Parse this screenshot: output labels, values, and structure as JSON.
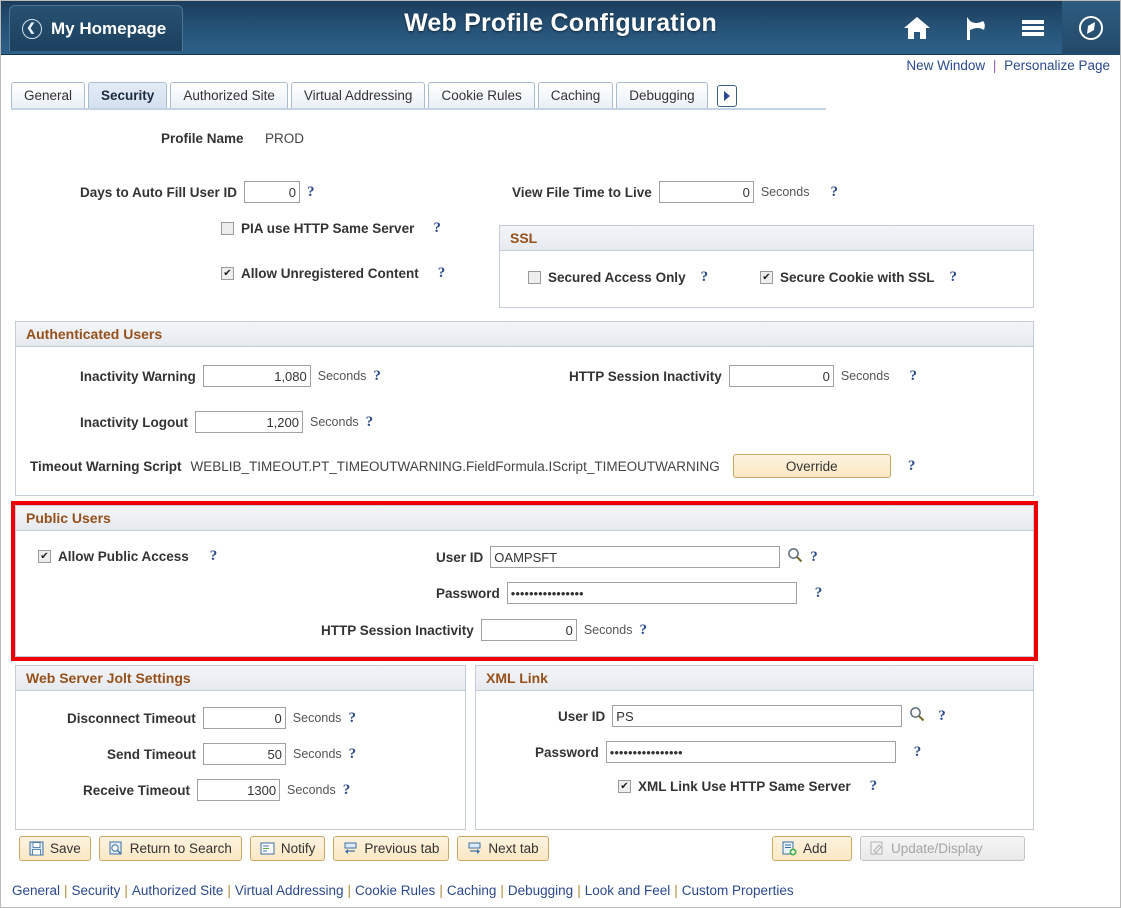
{
  "header": {
    "homepage_label": "My Homepage",
    "title": "Web Profile Configuration",
    "icons": [
      "home-icon",
      "flag-icon",
      "menu-icon",
      "navigator-icon"
    ]
  },
  "util": {
    "new_window": "New Window",
    "separator": "|",
    "personalize": "Personalize Page"
  },
  "tabs": [
    {
      "label": "General",
      "active": false
    },
    {
      "label": "Security",
      "active": true
    },
    {
      "label": "Authorized Site",
      "active": false
    },
    {
      "label": "Virtual Addressing",
      "active": false
    },
    {
      "label": "Cookie Rules",
      "active": false
    },
    {
      "label": "Caching",
      "active": false
    },
    {
      "label": "Debugging",
      "active": false
    }
  ],
  "profile": {
    "name_label": "Profile Name",
    "name_value": "PROD"
  },
  "top": {
    "days_autofill_label": "Days to Auto Fill User ID",
    "days_autofill_value": "0",
    "pia_same_server_label": "PIA use HTTP Same Server",
    "pia_same_server_checked": false,
    "allow_unregistered_label": "Allow Unregistered Content",
    "allow_unregistered_checked": true,
    "view_file_ttl_label": "View File Time to Live",
    "view_file_ttl_value": "0",
    "seconds": "Seconds",
    "help": "?"
  },
  "ssl": {
    "title": "SSL",
    "secured_access_label": "Secured Access Only",
    "secured_access_checked": false,
    "secure_cookie_label": "Secure Cookie with SSL",
    "secure_cookie_checked": true
  },
  "authenticated_users": {
    "title": "Authenticated Users",
    "inactivity_warning_label": "Inactivity Warning",
    "inactivity_warning_value": "1,080",
    "inactivity_logout_label": "Inactivity Logout",
    "inactivity_logout_value": "1,200",
    "http_session_label": "HTTP Session Inactivity",
    "http_session_value": "0",
    "seconds": "Seconds",
    "timeout_script_label": "Timeout Warning Script",
    "timeout_script_value": "WEBLIB_TIMEOUT.PT_TIMEOUTWARNING.FieldFormula.IScript_TIMEOUTWARNING",
    "override_label": "Override"
  },
  "public_users": {
    "title": "Public Users",
    "allow_public_label": "Allow Public Access",
    "allow_public_checked": true,
    "user_id_label": "User ID",
    "user_id_value": "OAMPSFT",
    "password_label": "Password",
    "password_value": "••••••••••••••••",
    "http_session_label": "HTTP Session Inactivity",
    "http_session_value": "0",
    "seconds": "Seconds",
    "highlight_color": "#ee0000"
  },
  "jolt": {
    "title": "Web Server Jolt Settings",
    "disconnect_label": "Disconnect Timeout",
    "disconnect_value": "0",
    "send_label": "Send Timeout",
    "send_value": "50",
    "receive_label": "Receive Timeout",
    "receive_value": "1300",
    "seconds": "Seconds"
  },
  "xml_link": {
    "title": "XML Link",
    "user_id_label": "User ID",
    "user_id_value": "PS",
    "password_label": "Password",
    "password_value": "••••••••••••••••",
    "same_server_label": "XML Link Use HTTP Same Server",
    "same_server_checked": true
  },
  "toolbar": {
    "save": "Save",
    "return_to_search": "Return to Search",
    "notify": "Notify",
    "previous_tab": "Previous tab",
    "next_tab": "Next tab",
    "add": "Add",
    "update_display": "Update/Display"
  },
  "footer_links": [
    "General",
    "Security",
    "Authorized Site",
    "Virtual Addressing",
    "Cookie Rules",
    "Caching",
    "Debugging",
    "Look and Feel",
    "Custom Properties"
  ]
}
